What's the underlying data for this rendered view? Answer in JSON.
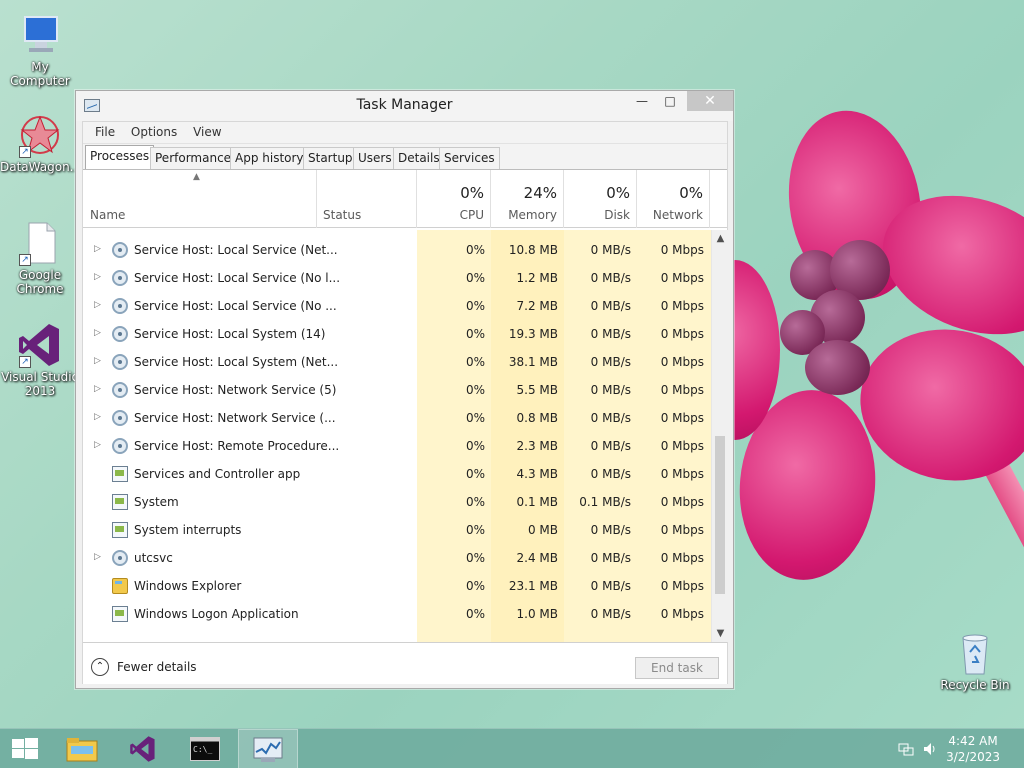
{
  "window": {
    "title": "Task Manager",
    "min_glyph": "—",
    "max_glyph": "□",
    "close_glyph": "✕"
  },
  "menu": [
    "File",
    "Options",
    "View"
  ],
  "tabs": [
    "Processes",
    "Performance",
    "App history",
    "Startup",
    "Users",
    "Details",
    "Services"
  ],
  "active_tab": "Processes",
  "columns": {
    "name": "Name",
    "status": "Status",
    "cpu": {
      "pct": "0%",
      "label": "CPU"
    },
    "memory": {
      "pct": "24%",
      "label": "Memory"
    },
    "disk": {
      "pct": "0%",
      "label": "Disk"
    },
    "network": {
      "pct": "0%",
      "label": "Network"
    }
  },
  "processes": [
    {
      "name": "Service Host: Local Service (Net...",
      "expandable": true,
      "icon": "gear",
      "cpu": "0%",
      "memory": "10.8 MB",
      "disk": "0 MB/s",
      "network": "0 Mbps"
    },
    {
      "name": "Service Host: Local Service (No l...",
      "expandable": true,
      "icon": "gear",
      "cpu": "0%",
      "memory": "1.2 MB",
      "disk": "0 MB/s",
      "network": "0 Mbps"
    },
    {
      "name": "Service Host: Local Service (No ...",
      "expandable": true,
      "icon": "gear",
      "cpu": "0%",
      "memory": "7.2 MB",
      "disk": "0 MB/s",
      "network": "0 Mbps"
    },
    {
      "name": "Service Host: Local System (14)",
      "expandable": true,
      "icon": "gear",
      "cpu": "0%",
      "memory": "19.3 MB",
      "disk": "0 MB/s",
      "network": "0 Mbps"
    },
    {
      "name": "Service Host: Local System (Net...",
      "expandable": true,
      "icon": "gear",
      "cpu": "0%",
      "memory": "38.1 MB",
      "disk": "0 MB/s",
      "network": "0 Mbps"
    },
    {
      "name": "Service Host: Network Service (5)",
      "expandable": true,
      "icon": "gear",
      "cpu": "0%",
      "memory": "5.5 MB",
      "disk": "0 MB/s",
      "network": "0 Mbps"
    },
    {
      "name": "Service Host: Network Service (...",
      "expandable": true,
      "icon": "gear",
      "cpu": "0%",
      "memory": "0.8 MB",
      "disk": "0 MB/s",
      "network": "0 Mbps"
    },
    {
      "name": "Service Host: Remote Procedure...",
      "expandable": true,
      "icon": "gear",
      "cpu": "0%",
      "memory": "2.3 MB",
      "disk": "0 MB/s",
      "network": "0 Mbps"
    },
    {
      "name": "Services and Controller app",
      "expandable": false,
      "icon": "window",
      "cpu": "0%",
      "memory": "4.3 MB",
      "disk": "0 MB/s",
      "network": "0 Mbps"
    },
    {
      "name": "System",
      "expandable": false,
      "icon": "window",
      "cpu": "0%",
      "memory": "0.1 MB",
      "disk": "0.1 MB/s",
      "network": "0 Mbps"
    },
    {
      "name": "System interrupts",
      "expandable": false,
      "icon": "window",
      "cpu": "0%",
      "memory": "0 MB",
      "disk": "0 MB/s",
      "network": "0 Mbps"
    },
    {
      "name": "utcsvc",
      "expandable": true,
      "icon": "gear",
      "cpu": "0%",
      "memory": "2.4 MB",
      "disk": "0 MB/s",
      "network": "0 Mbps"
    },
    {
      "name": "Windows Explorer",
      "expandable": false,
      "icon": "folder",
      "cpu": "0%",
      "memory": "23.1 MB",
      "disk": "0 MB/s",
      "network": "0 Mbps"
    },
    {
      "name": "Windows Logon Application",
      "expandable": false,
      "icon": "window",
      "cpu": "0%",
      "memory": "1.0 MB",
      "disk": "0 MB/s",
      "network": "0 Mbps"
    }
  ],
  "footer": {
    "fewer_details": "Fewer details",
    "end_task": "End task"
  },
  "desktop_icons": {
    "my_computer": "My Computer",
    "datawagon": "DataWagon...",
    "chrome_line1": "Google",
    "chrome_line2": "Chrome",
    "vs_line1": "Visual Studio",
    "vs_line2": "2013",
    "recycle_bin": "Recycle Bin"
  },
  "taskbar": {
    "time": "4:42 AM",
    "date": "3/2/2023"
  },
  "colors": {
    "accent_highlight": "#fff4c4",
    "taskbar": "#6ca99c",
    "flower": "#d3186f"
  }
}
